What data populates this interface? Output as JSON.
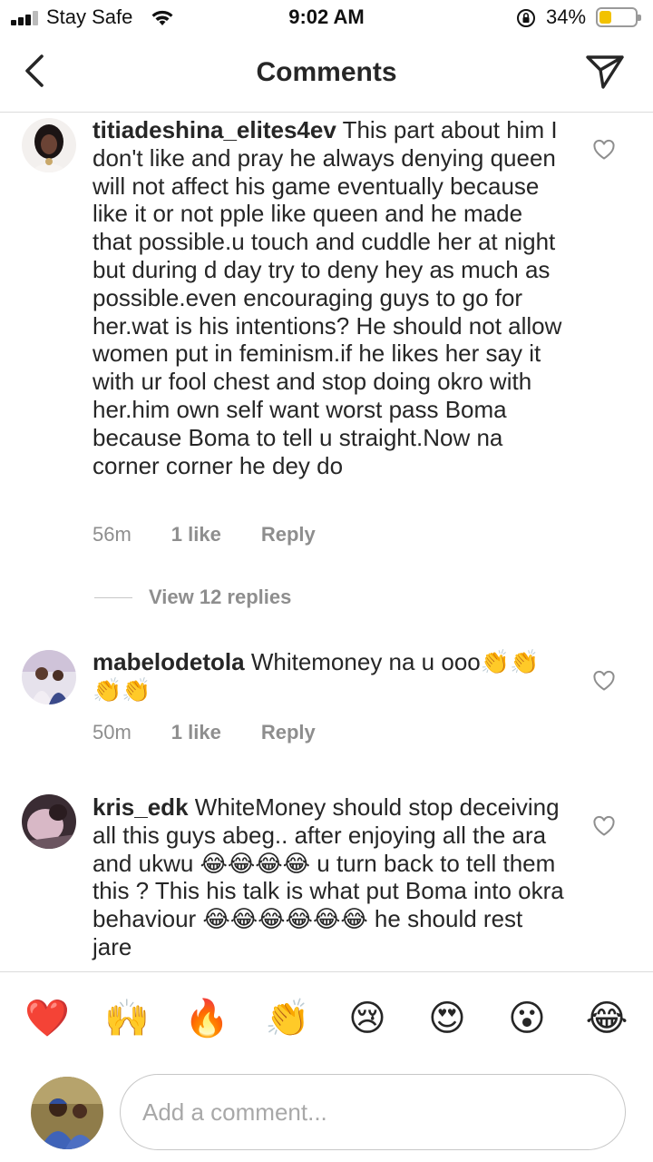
{
  "status_bar": {
    "carrier": "Stay Safe",
    "time": "9:02 AM",
    "battery_percent": "34%",
    "battery_level": 0.34,
    "battery_color": "#f2c200",
    "icons": [
      "signal-icon",
      "wifi-icon",
      "rotation-lock-icon",
      "battery-icon"
    ]
  },
  "header": {
    "title": "Comments",
    "back_icon": "chevron-left-icon",
    "send_icon": "send-icon"
  },
  "comments": [
    {
      "username": "titiadeshina_elites4ev",
      "text": " This part about him I don't like and pray he always denying queen will not affect his game eventually because like it or not pple like queen and he made that possible.u touch and cuddle her at night but during d day try to deny hey as much as possible.even encouraging guys to go for her.wat is his intentions? He should not allow women put in feminism.if he likes her say it with ur fool chest and stop doing okro with her.him own self want worst pass Boma because Boma to tell u straight.Now na corner corner he dey do",
      "time": "56m",
      "likes": "1 like",
      "reply": "Reply",
      "view_replies": "View 12 replies"
    },
    {
      "username": "mabelodetola",
      "text": " Whitemoney na u ooo👏👏👏👏",
      "time": "50m",
      "likes": "1 like",
      "reply": "Reply"
    },
    {
      "username": "kris_edk",
      "text": " WhiteMoney should stop deceiving all this guys abeg.. after enjoying all the ara and ukwu 😂😂😂😂 u turn back to tell them this ? This his talk is what put Boma into okra behaviour 😂😂😂😂😂😂 he should rest jare"
    }
  ],
  "emoji_bar": [
    "❤️",
    "🙌",
    "🔥",
    "👏",
    "😢",
    "😍",
    "😮",
    "😂"
  ],
  "composer": {
    "placeholder": "Add a comment..."
  },
  "colors": {
    "text": "#262626",
    "secondary": "#8e8e8e",
    "divider": "#dbdbdb"
  }
}
